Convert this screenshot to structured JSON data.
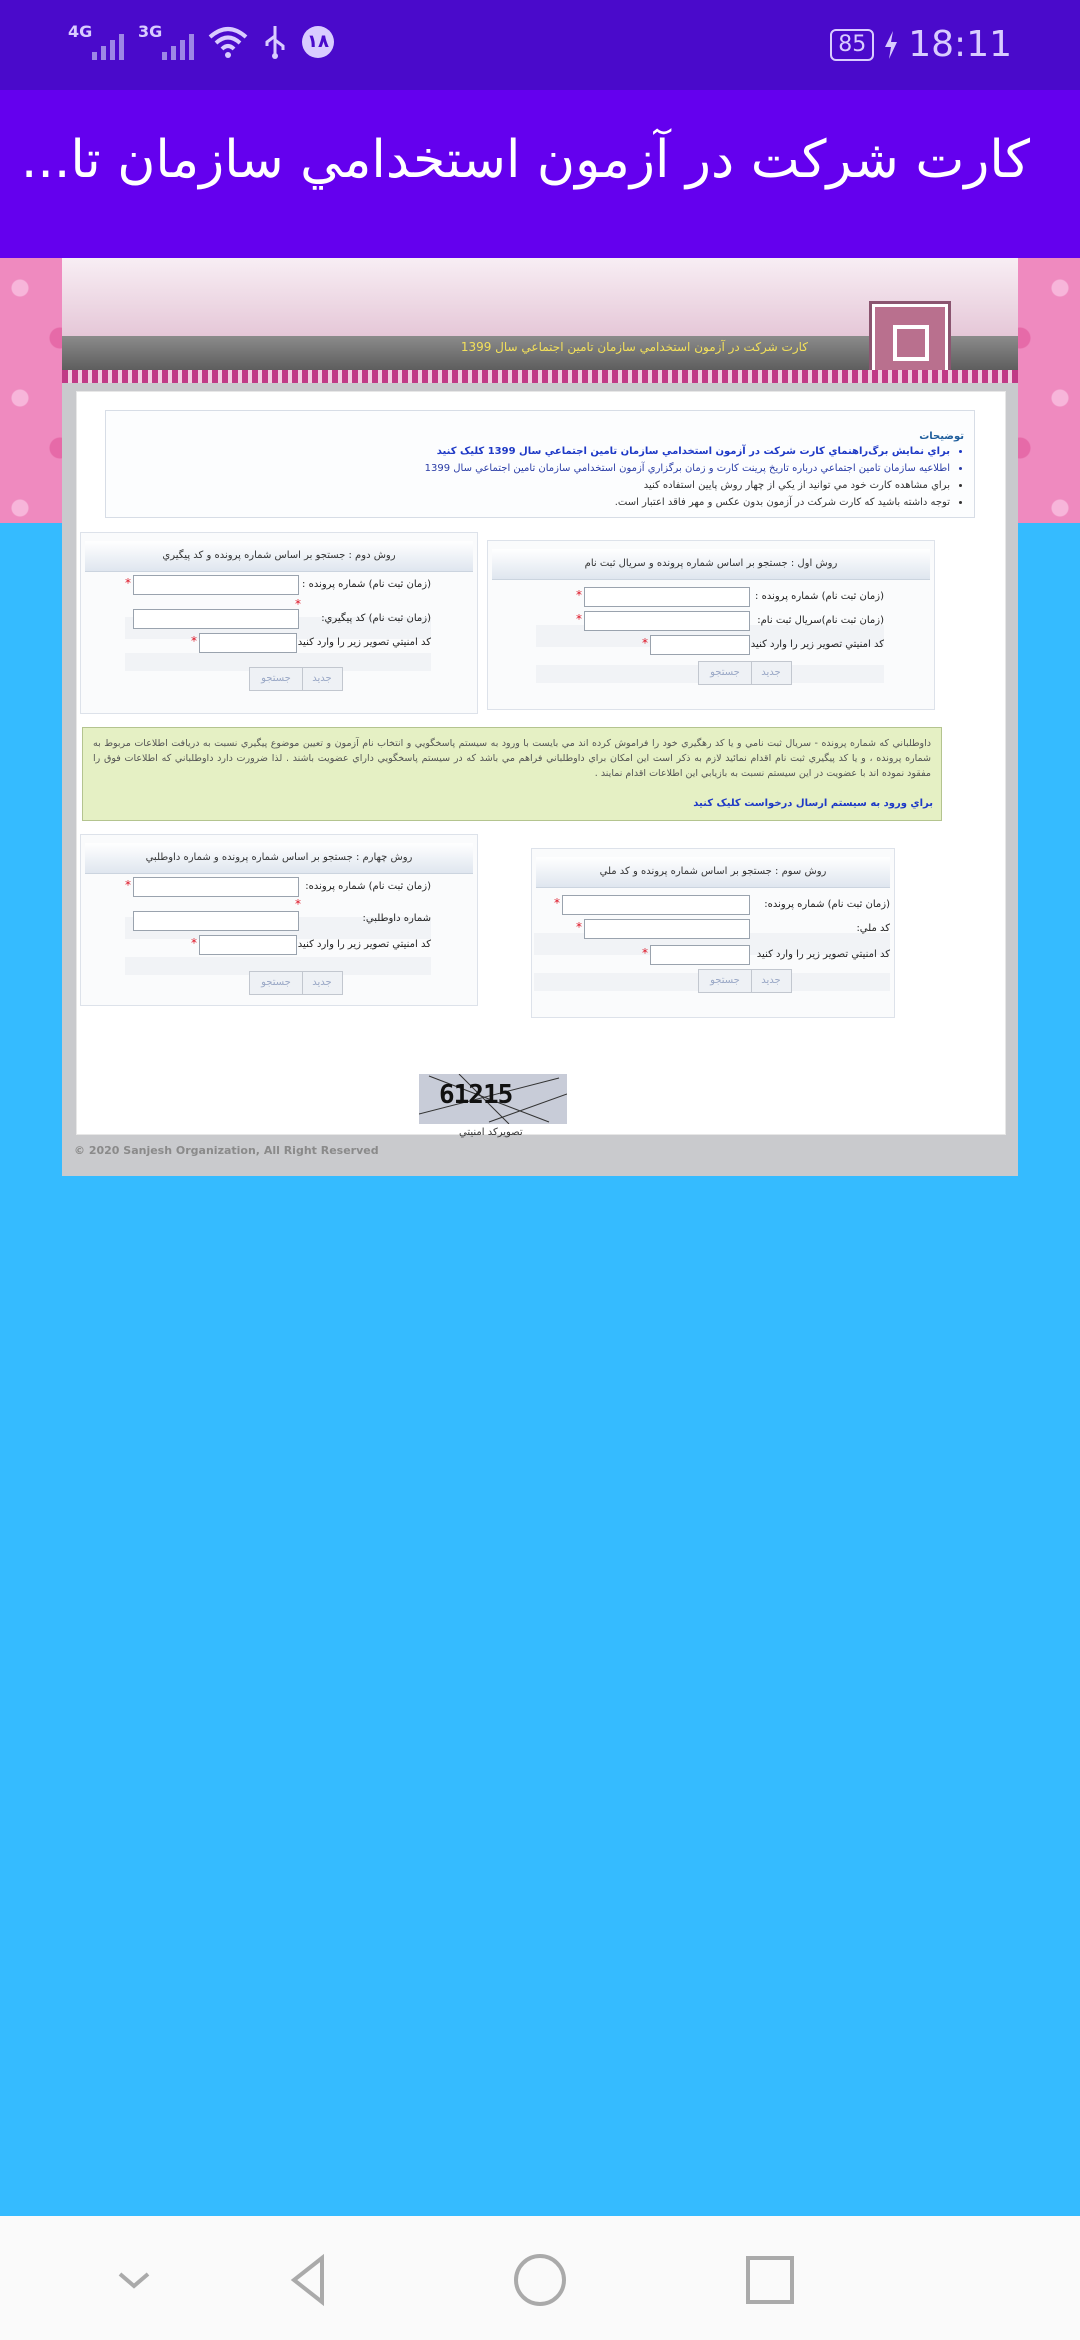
{
  "status_bar": {
    "net1": "4G",
    "net2": "3G",
    "badge": "۱۸",
    "battery": "85",
    "time": "18:11"
  },
  "header": {
    "title": "کارت شرکت در آزمون استخدامي سازمان تا..."
  },
  "banner": {
    "text": "کارت شرکت در آزمون استخدامي سازمان تامين اجتماعي سال 1399"
  },
  "description": {
    "title": "توضيحات",
    "items": [
      "براي نمايش برگ‌راهنماي کارت شرکت در آزمون استخدامي سازمان تامين اجتماعي سال 1399 کليک کنيد",
      "اطلاعيه سازمان تامين اجتماعي درباره تاريخ پرينت کارت و زمان برگزاري آزمون استخدامي سازمان تامين اجتماعي سال 1399",
      "براي مشاهده کارت خود مي توانيد از يکي از چهار روش پايين استفاده کنيد",
      "توجه داشته باشيد که کارت شرکت در آزمون بدون عکس و مهر فاقد اعتبار است."
    ]
  },
  "method1": {
    "title": "روش اول : جستجو بر اساس شماره پرونده و سريال ثبت نام",
    "label1": "(زمان ثبت نام) شماره پرونده :",
    "label2": "(زمان ثبت نام)سريال ثبت نام:",
    "label3": "کد امنيتي تصوير زير را وارد کنيد",
    "new": "جديد",
    "search": "جستجو"
  },
  "method2": {
    "title": "روش دوم : جستجو بر اساس شماره پرونده و کد پيگيري",
    "label1": "(زمان ثبت نام) شماره پرونده :",
    "label2": "(زمان ثبت نام) کد پيگيري:",
    "label3": "کد امنيتي تصوير زير را وارد کنيد",
    "new": "جديد",
    "search": "جستجو"
  },
  "notice": {
    "text": "داوطلباني که شماره پرونده - سريال ثبت نامي و يا کد رهگيري خود را فراموش کرده اند مي بايست با ورود به سيستم پاسخگويي و انتخاب نام آزمون و تعيين موضوع پيگيري نسبت به دريافت اطلاعات مربوط به شماره پرونده ، و يا کد پيگيري ثبت نام اقدام نمائيد لازم به ذکر است اين امکان براي داوطلباني فراهم مي باشد که در سيستم پاسخگويي داراي عضويت باشند . لذا ضرورت دارد داوطلباني که اطلاعات فوق را مفقود نموده اند با عضويت در اين سيستم نسبت به بازيابي اين اطلاعات اقدام نمايند .",
    "link": "براي ورود به سيستم ارسال درخواست کليک کنيد"
  },
  "method3": {
    "title": "روش سوم : جستجو بر اساس شماره پرونده و کد ملي",
    "label1": "(زمان ثبت نام) شماره پرونده:",
    "label2": "کد ملي:",
    "label3": "کد امنيتي تصوير زير را وارد کنيد",
    "new": "جديد",
    "search": "جستجو"
  },
  "method4": {
    "title": "روش چهارم : جستجو بر اساس شماره پرونده و شماره داوطلبي",
    "label1": "(زمان ثبت نام) شماره پرونده:",
    "label2": "شماره داوطلبي:",
    "label3": "کد امنيتي تصوير زير را وارد کنيد",
    "new": "جديد",
    "search": "جستجو"
  },
  "captcha": {
    "text": "61215",
    "label": "تصويرکد امنيتي"
  },
  "footer": {
    "text": "© 2020 Sanjesh Organization, All Right Reserved"
  }
}
